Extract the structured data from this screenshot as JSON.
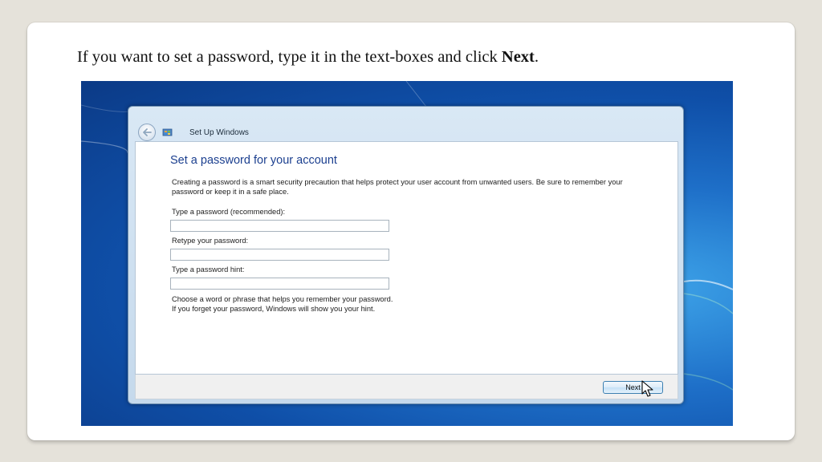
{
  "slide": {
    "instruction_prefix": "If you want to set a password, type it in the text-boxes and click ",
    "instruction_bold": "Next",
    "instruction_suffix": "."
  },
  "window": {
    "title": "Set Up Windows",
    "heading": "Set a password for your account",
    "description": "Creating a password is a smart security precaution that helps protect your user account from unwanted users. Be sure to remember your password or keep it in a safe place.",
    "fields": [
      {
        "label": "Type a password (recommended):",
        "value": ""
      },
      {
        "label": "Retype your password:",
        "value": ""
      },
      {
        "label": "Type a password hint:",
        "value": ""
      }
    ],
    "hint_note_line1": "Choose a word or phrase that helps you remember your password.",
    "hint_note_line2": "If you forget your password, Windows will show you your hint.",
    "next_label": "Next"
  },
  "icons": {
    "back": "back-arrow-icon",
    "app": "windows-setup-icon",
    "cursor": "mouse-pointer-icon"
  },
  "colors": {
    "heading": "#1b3f8f",
    "desktop": "#1e6fc8",
    "slide_background": "#e5e2da"
  }
}
